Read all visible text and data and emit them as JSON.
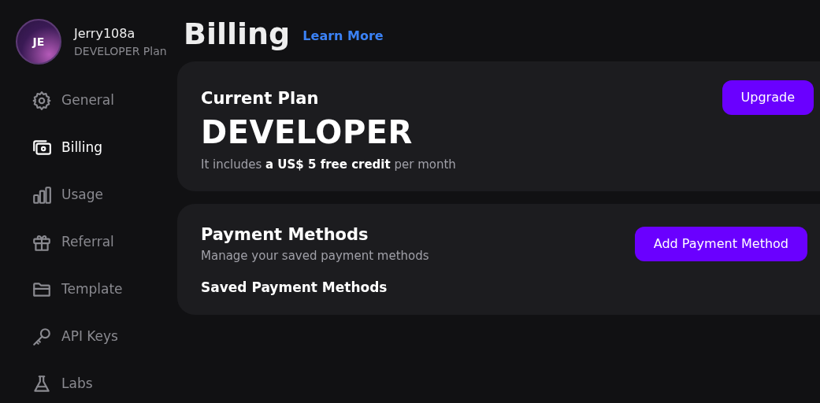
{
  "profile": {
    "initials": "JE",
    "username": "Jerry108a",
    "plan": "DEVELOPER Plan"
  },
  "sidebar": {
    "items": [
      {
        "label": "General",
        "selected": false
      },
      {
        "label": "Billing",
        "selected": true
      },
      {
        "label": "Usage",
        "selected": false
      },
      {
        "label": "Referral",
        "selected": false
      },
      {
        "label": "Template",
        "selected": false
      },
      {
        "label": "API Keys",
        "selected": false
      },
      {
        "label": "Labs",
        "selected": false
      }
    ]
  },
  "header": {
    "title": "Billing",
    "link": "Learn More"
  },
  "current_plan": {
    "title": "Current Plan",
    "button": "Upgrade",
    "plan_name": "DEVELOPER",
    "description": "It includes **a US$ 5 free credit** per month"
  },
  "payment_methods": {
    "title": "Payment Methods",
    "button": "Add Payment Method",
    "subtitle": "Manage your saved payment methods",
    "section": "Saved Payment Methods"
  }
}
